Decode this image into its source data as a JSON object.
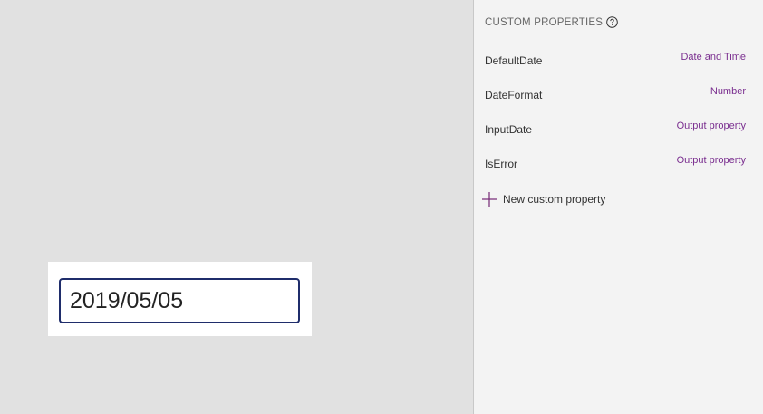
{
  "canvas": {
    "date_input": {
      "value": "2019/05/05"
    }
  },
  "panel": {
    "title": "CUSTOM PROPERTIES",
    "help_icon": "help-circle-icon",
    "properties": [
      {
        "name": "DefaultDate",
        "type": "Date and Time"
      },
      {
        "name": "DateFormat",
        "type": "Number"
      },
      {
        "name": "InputDate",
        "type": "Output property"
      },
      {
        "name": "IsError",
        "type": "Output property"
      }
    ],
    "new_property": {
      "icon": "plus-icon",
      "label": "New custom property"
    }
  },
  "colors": {
    "canvas_bg": "#e1e1e1",
    "panel_bg": "#f3f3f3",
    "input_border": "#1f2d6b",
    "type_text": "#7a2e8f",
    "accent_purple": "#742774"
  }
}
